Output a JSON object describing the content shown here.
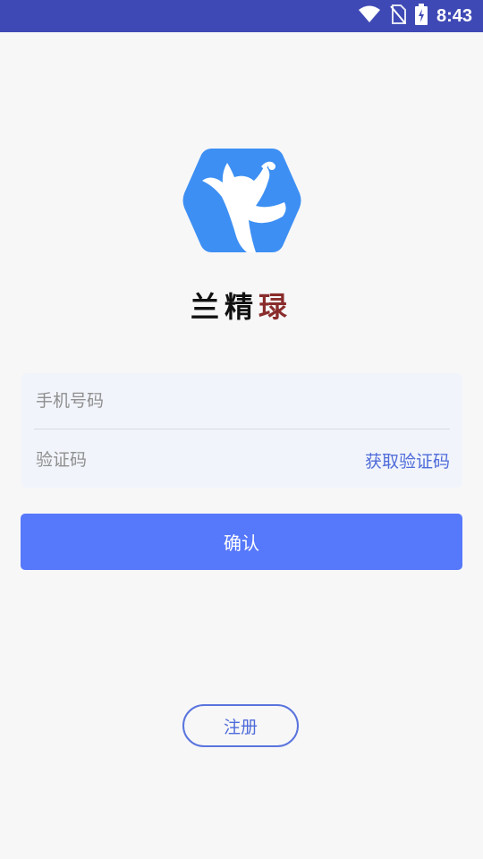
{
  "status_bar": {
    "time": "8:43",
    "icons": [
      "wifi-icon",
      "no-sim-icon",
      "battery-charging-icon"
    ]
  },
  "brand": {
    "name_part1": "兰精",
    "name_part2": "琭",
    "logo_icon": "fairy-hexagon-logo",
    "logo_color": "#3d8ff3"
  },
  "login_form": {
    "phone_placeholder": "手机号码",
    "code_placeholder": "验证码",
    "get_code_label": "获取验证码"
  },
  "actions": {
    "confirm_label": "确认",
    "register_label": "注册"
  },
  "colors": {
    "status_bar": "#3f49b5",
    "primary": "#5678fb",
    "link": "#4e6bd9"
  }
}
